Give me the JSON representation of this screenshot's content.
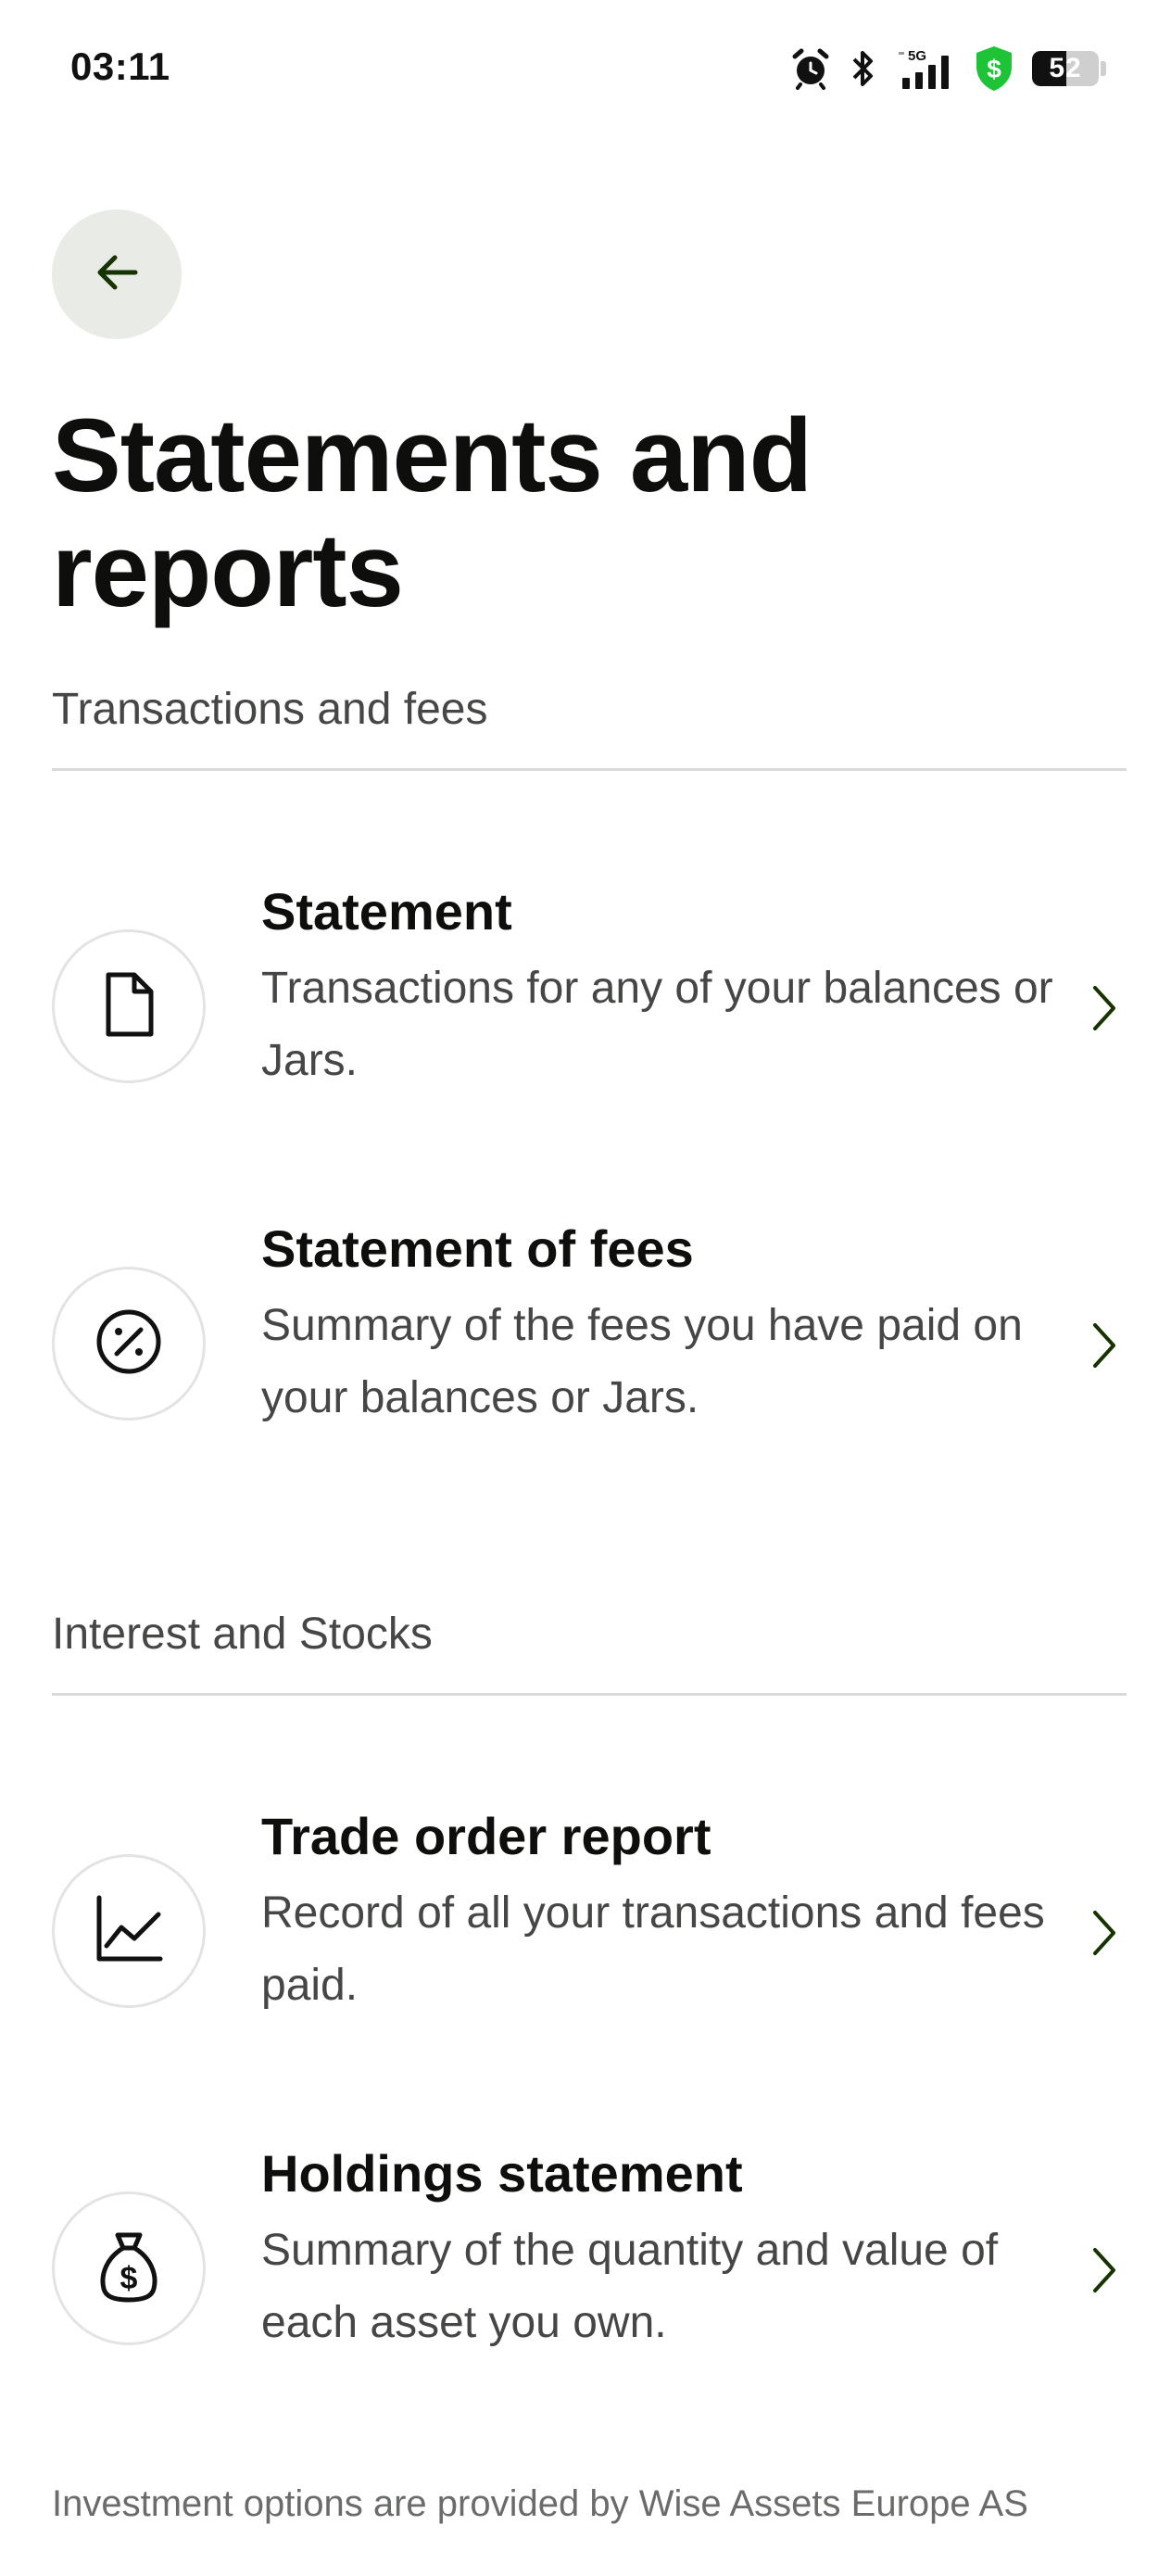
{
  "status_bar": {
    "time": "03:11",
    "network": "5G",
    "battery_level": "52",
    "battery_fraction": 0.52,
    "icons": [
      "alarm-icon",
      "bluetooth-icon",
      "signal-icon",
      "security-shield-icon",
      "battery-icon"
    ],
    "shield_color": "#1ec337"
  },
  "header": {
    "back_icon": "arrow-left-icon",
    "title": "Statements and reports"
  },
  "sections": [
    {
      "header": "Transactions and fees",
      "items": [
        {
          "icon": "document-icon",
          "title": "Statement",
          "description": "Transactions for any of your balances or Jars."
        },
        {
          "icon": "percent-icon",
          "title": "Statement of fees",
          "description": "Summary of the fees you have paid on your balances or Jars."
        }
      ]
    },
    {
      "header": "Interest and Stocks",
      "items": [
        {
          "icon": "line-chart-icon",
          "title": "Trade order report",
          "description": "Record of all your transactions and fees paid."
        },
        {
          "icon": "money-bag-icon",
          "title": "Holdings statement",
          "description": "Summary of the quantity and value of each asset you own."
        }
      ]
    }
  ],
  "footer": {
    "note": "Investment options are provided by Wise Assets Europe AS"
  },
  "colors": {
    "accent": "#163300",
    "back_button_bg": "#e8ebe6",
    "text_primary": "#0e0f0c",
    "text_secondary": "#454745"
  }
}
